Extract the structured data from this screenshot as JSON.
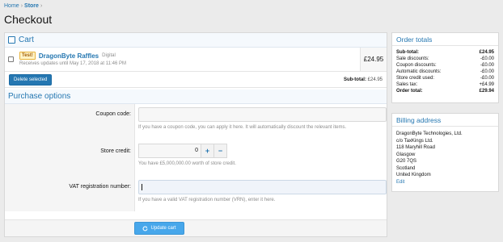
{
  "breadcrumb": {
    "home": "Home",
    "store": "Store"
  },
  "page_title": "Checkout",
  "cart": {
    "header": "Cart",
    "item": {
      "badge": "Test!",
      "title": "DragonByte Raffles",
      "type": "Digital",
      "subtitle": "Receives updates until May 17, 2018 at 11:46 PM",
      "price": "£24.95"
    },
    "delete_button": "Delete selected",
    "subtotal_label": "Sub-total:",
    "subtotal_value": "£24.95"
  },
  "purchase": {
    "header": "Purchase options",
    "coupon": {
      "label": "Coupon code:",
      "value": "",
      "hint": "If you have a coupon code, you can apply it here. It will automatically discount the relevant items."
    },
    "credit": {
      "label": "Store credit:",
      "value": "0",
      "plus": "+",
      "minus": "−",
      "hint": "You have £5,000,000.00 worth of store credit."
    },
    "vat": {
      "label": "VAT registration number:",
      "value": "",
      "hint": "If you have a valid VAT registration number (VRN), enter it here."
    },
    "update_button": "Update cart"
  },
  "order_totals": {
    "header": "Order totals",
    "rows": [
      {
        "label": "Sub-total:",
        "value": "£24.95"
      },
      {
        "label": "Sale discounts:",
        "value": "-£0.00"
      },
      {
        "label": "Coupon discounts:",
        "value": "-£0.00"
      },
      {
        "label": "Automatic discounts:",
        "value": "-£0.00"
      },
      {
        "label": "Store credit used:",
        "value": "-£0.00"
      },
      {
        "label": "Sales tax:",
        "value": "+£4.99"
      },
      {
        "label": "Order total:",
        "value": "£29.94"
      }
    ]
  },
  "billing": {
    "header": "Billing address",
    "lines": [
      "DragonByte Technologies, Ltd.",
      "c/o TaxKings Ltd.",
      "118 Maryhill Road",
      "Glasgow",
      "G20 7QS",
      "Scotland",
      "United Kingdom"
    ],
    "edit_link": "Edit"
  },
  "icons": {
    "refresh": "refresh-icon",
    "checkbox": "checkbox-icon"
  },
  "colors": {
    "accent": "#2577b1",
    "button": "#47a7eb"
  }
}
